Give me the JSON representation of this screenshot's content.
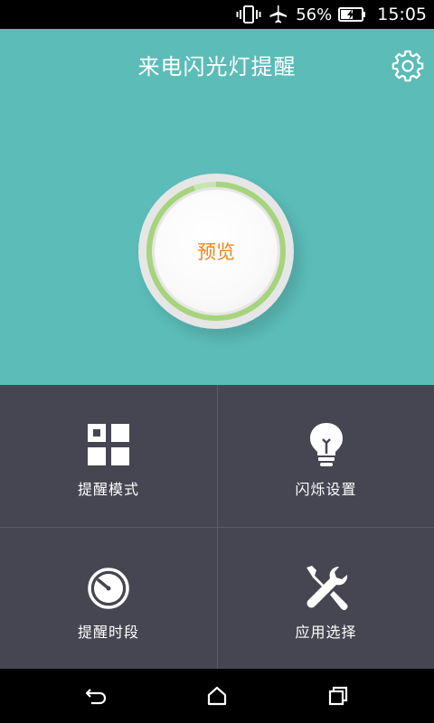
{
  "status_bar": {
    "battery_percent": "56%",
    "time": "15:05",
    "icons": [
      "vibrate-icon",
      "airplane-icon",
      "battery-charging-icon"
    ]
  },
  "header": {
    "title": "来电闪光灯提醒",
    "settings_icon": "gear-icon"
  },
  "preview": {
    "label": "预览",
    "label_color": "#f0841c",
    "ring_color": "#a6d47d"
  },
  "tiles": [
    {
      "label": "提醒模式",
      "icon": "grid-icon"
    },
    {
      "label": "闪烁设置",
      "icon": "lightbulb-icon"
    },
    {
      "label": "提醒时段",
      "icon": "timer-icon"
    },
    {
      "label": "应用选择",
      "icon": "tools-icon"
    }
  ],
  "nav_bar": {
    "icons": [
      "back-icon",
      "home-icon",
      "recents-icon"
    ]
  },
  "colors": {
    "accent": "#5bbcb8",
    "panel": "#464552"
  }
}
